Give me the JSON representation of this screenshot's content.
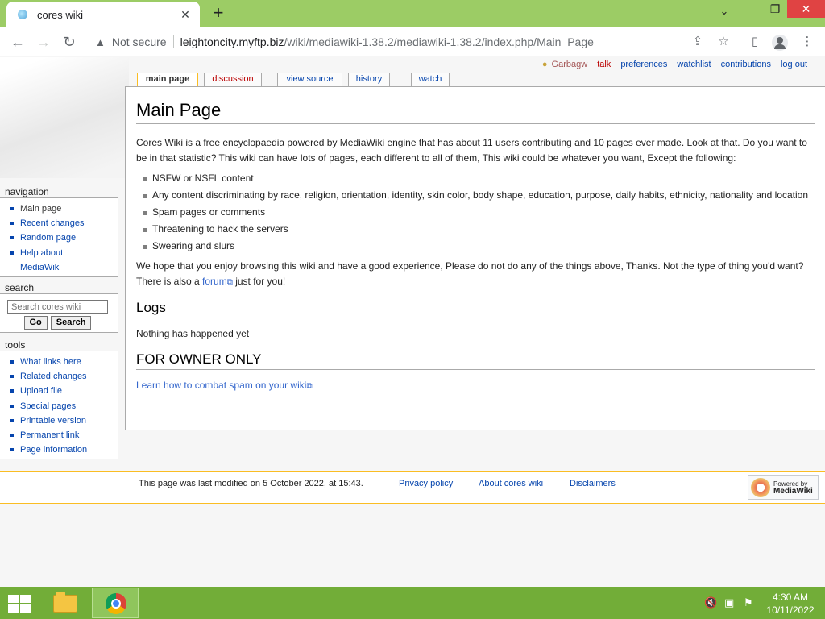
{
  "browser": {
    "tab_title": "cores wiki",
    "new_tab": "+",
    "close_tab": "✕",
    "security": "Not secure",
    "url_host": "leightoncity.myftp.biz",
    "url_path": "/wiki/mediawiki-1.38.2/mediawiki-1.38.2/index.php/Main_Page"
  },
  "personal": {
    "user": "Garbagw",
    "talk": "talk",
    "preferences": "preferences",
    "watchlist": "watchlist",
    "contributions": "contributions",
    "logout": "log out"
  },
  "page_tabs": {
    "main_page": "main page",
    "discussion": "discussion",
    "view_source": "view source",
    "history": "history",
    "watch": "watch"
  },
  "article": {
    "title": "Main Page",
    "intro": "Cores Wiki is a free encyclopaedia powered by MediaWiki engine that has about 11 users contributing and 10 pages ever made. Look at that. Do you want to be in that statistic? This wiki can have lots of pages, each different to all of them, This wiki could be whatever you want, Except the following:",
    "rules": [
      "NSFW or NSFL content",
      "Any content discriminating by race, religion, orientation, identity, skin color, body shape, education, purpose, daily habits, ethnicity, nationality and location",
      "Spam pages or comments",
      "Threatening to hack the servers",
      "Swearing and slurs"
    ],
    "closing_before": "We hope that you enjoy browsing this wiki and have a good experience, Please do not do any of the things above, Thanks. Not the type of thing you'd want? There is also a ",
    "closing_link": "forum",
    "closing_after": " just for you!",
    "logs_heading": "Logs",
    "logs_text": "Nothing has happened yet",
    "owner_heading": "FOR OWNER ONLY",
    "owner_link": "Learn how to combat spam on your wiki"
  },
  "sidebar": {
    "navigation_title": "navigation",
    "navigation": [
      "Main page",
      "Recent changes",
      "Random page",
      "Help about MediaWiki"
    ],
    "search_title": "search",
    "search_placeholder": "Search cores wiki",
    "go": "Go",
    "search": "Search",
    "tools_title": "tools",
    "tools": [
      "What links here",
      "Related changes",
      "Upload file",
      "Special pages",
      "Printable version",
      "Permanent link",
      "Page information"
    ]
  },
  "footer": {
    "last_modified": "This page was last modified on 5 October 2022, at 15:43.",
    "privacy": "Privacy policy",
    "about": "About cores wiki",
    "disclaimers": "Disclaimers",
    "powered_line1": "Powered by",
    "powered_line2": "MediaWiki"
  },
  "taskbar": {
    "time": "4:30 AM",
    "date": "10/11/2022"
  },
  "colors": {
    "chrome_frame": "#9ccc65",
    "taskbar": "#72ad38",
    "link": "#0645ad",
    "new_link": "#ba0000",
    "tab_highlight": "#fabd23"
  }
}
